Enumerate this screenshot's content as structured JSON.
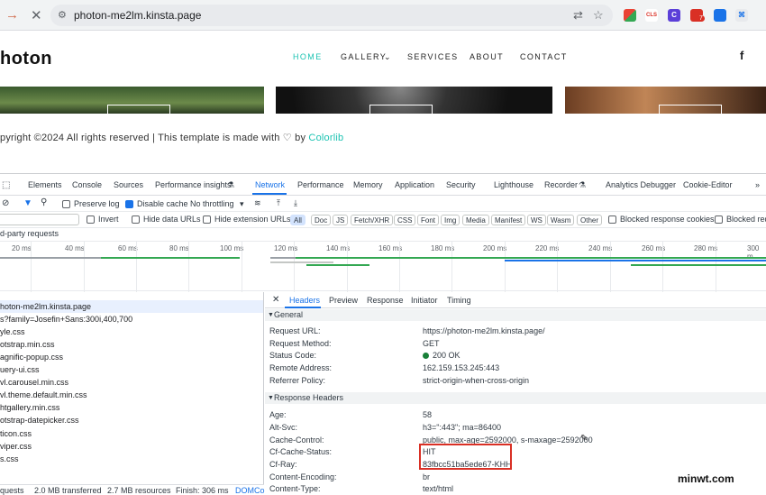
{
  "browser": {
    "url": "photon-me2lm.kinsta.page",
    "extensions": [
      "google-photos-icon",
      "cls-extension-icon",
      "c-extension-icon",
      "notification-badge-icon",
      "blue-extension-icon",
      "code-extension-icon"
    ],
    "badge_count": "7",
    "ext_cls_label": "CLS",
    "ext_c_label": "C"
  },
  "site": {
    "logo": "hoton",
    "nav": [
      "HOME",
      "GALLERY",
      "SERVICES",
      "ABOUT",
      "CONTACT"
    ],
    "footer_text": "pyright ©2024 All rights reserved | This template is made with",
    "footer_by": "by",
    "footer_brand": "Colorlib",
    "thumb_labels": [
      "",
      "",
      ""
    ]
  },
  "devtools": {
    "tabs": [
      "Elements",
      "Console",
      "Sources",
      "Performance insights",
      "Network",
      "Performance",
      "Memory",
      "Application",
      "Security",
      "Lighthouse",
      "Recorder",
      "Analytics Debugger",
      "Cookie-Editor"
    ],
    "active_tab": "Network",
    "toolbar": {
      "preserve_log": "Preserve log",
      "disable_cache": "Disable cache",
      "throttling": "No throttling"
    },
    "filters": {
      "invert": "Invert",
      "hide_data_urls": "Hide data URLs",
      "hide_extension_urls": "Hide extension URLs",
      "types": [
        "All",
        "Doc",
        "JS",
        "Fetch/XHR",
        "CSS",
        "Font",
        "Img",
        "Media",
        "Manifest",
        "WS",
        "Wasm",
        "Other"
      ],
      "blocked_cookies": "Blocked response cookies",
      "blocked_requests": "Blocked requ"
    },
    "third_party": "d-party requests",
    "timeline_ticks": [
      "20 ms",
      "40 ms",
      "60 ms",
      "80 ms",
      "100 ms",
      "120 ms",
      "140 ms",
      "160 ms",
      "180 ms",
      "200 ms",
      "220 ms",
      "240 ms",
      "260 ms",
      "280 ms",
      "300 m"
    ],
    "requests": [
      "hoton-me2lm.kinsta.page",
      "s?family=Josefin+Sans:300i,400,700",
      "yle.css",
      "otstrap.min.css",
      "agnific-popup.css",
      "uery-ui.css",
      "vl.carousel.min.css",
      "vl.theme.default.min.css",
      "htgallery.min.css",
      "otstrap-datepicker.css",
      "ticon.css",
      "viper.css",
      "s.css"
    ],
    "status": {
      "requests": "quests",
      "transferred": "2.0 MB transferred",
      "resources": "2.7 MB resources",
      "finish": "Finish: 306 ms",
      "domcontent": "DOMCo"
    },
    "detail_tabs": [
      "Headers",
      "Preview",
      "Response",
      "Initiator",
      "Timing"
    ],
    "general_title": "General",
    "general": [
      {
        "k": "Request URL:",
        "v": "https://photon-me2lm.kinsta.page/"
      },
      {
        "k": "Request Method:",
        "v": "GET"
      },
      {
        "k": "Status Code:",
        "v": "200 OK"
      },
      {
        "k": "Remote Address:",
        "v": "162.159.153.245:443"
      },
      {
        "k": "Referrer Policy:",
        "v": "strict-origin-when-cross-origin"
      }
    ],
    "response_title": "Response Headers",
    "response": [
      {
        "k": "Age:",
        "v": "58"
      },
      {
        "k": "Alt-Svc:",
        "v": "h3=\":443\"; ma=86400"
      },
      {
        "k": "Cache-Control:",
        "v": "public, max-age=2592000, s-maxage=2592000"
      },
      {
        "k": "Cf-Cache-Status:",
        "v": "HIT"
      },
      {
        "k": "Cf-Ray:",
        "v": "83fbcc51ba5ede67-KHH"
      },
      {
        "k": "Content-Encoding:",
        "v": "br"
      },
      {
        "k": "Content-Type:",
        "v": "text/html"
      }
    ]
  },
  "watermark": "minwt.com"
}
